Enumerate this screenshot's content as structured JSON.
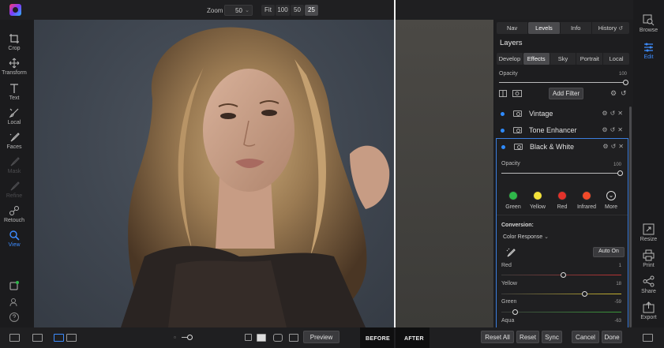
{
  "topbar": {
    "zoom_label": "Zoom",
    "zoom_value": "50",
    "zoom_buttons": [
      "Fit",
      "100",
      "50",
      "25"
    ]
  },
  "left_tools": [
    {
      "label": "Crop",
      "icon": "crop-icon"
    },
    {
      "label": "Transform",
      "icon": "transform-icon"
    },
    {
      "label": "Text",
      "icon": "text-icon"
    },
    {
      "label": "Local",
      "icon": "brush-icon"
    },
    {
      "label": "Faces",
      "icon": "faces-icon"
    },
    {
      "label": "Mask",
      "icon": "mask-icon"
    },
    {
      "label": "Refine",
      "icon": "refine-icon"
    },
    {
      "label": "Retouch",
      "icon": "retouch-icon"
    },
    {
      "label": "View",
      "icon": "view-icon"
    }
  ],
  "right_tools": [
    {
      "label": "Browse",
      "icon": "browse-icon"
    },
    {
      "label": "Edit",
      "icon": "edit-icon"
    },
    {
      "label": "Resize",
      "icon": "resize-icon"
    },
    {
      "label": "Print",
      "icon": "print-icon"
    },
    {
      "label": "Share",
      "icon": "share-icon"
    },
    {
      "label": "Export",
      "icon": "export-icon"
    }
  ],
  "panel": {
    "top_tabs": [
      "Nav",
      "Levels",
      "Info",
      "History"
    ],
    "title": "Layers",
    "module_tabs": [
      "Develop",
      "Effects",
      "Sky",
      "Portrait",
      "Local"
    ],
    "opacity_label": "Opacity",
    "opacity_value": "100",
    "add_filter_label": "Add Filter",
    "filters": [
      "Vintage",
      "Tone Enhancer",
      "Black & White"
    ],
    "bw": {
      "opacity_label": "Opacity",
      "opacity_value": "100",
      "presets": [
        {
          "label": "Green",
          "color": "#2fb84a"
        },
        {
          "label": "Yellow",
          "color": "#f3e23a"
        },
        {
          "label": "Red",
          "color": "#e3322b"
        },
        {
          "label": "Infrared",
          "color": "#f24a2a"
        },
        {
          "label": "More",
          "color": "#1d1d1f"
        }
      ],
      "conversion_label": "Conversion:",
      "conversion_mode": "Color Response",
      "auto_on_label": "Auto On",
      "sliders": [
        {
          "label": "Red",
          "value": "1"
        },
        {
          "label": "Yellow",
          "value": "18"
        },
        {
          "label": "Green",
          "value": "-59"
        },
        {
          "label": "Aqua",
          "value": "-63"
        }
      ]
    }
  },
  "bottombar": {
    "preview_label": "Preview",
    "before_label": "BEFORE",
    "after_label": "AFTER",
    "reset_all_label": "Reset All",
    "reset_label": "Reset",
    "sync_label": "Sync",
    "cancel_label": "Cancel",
    "done_label": "Done"
  }
}
